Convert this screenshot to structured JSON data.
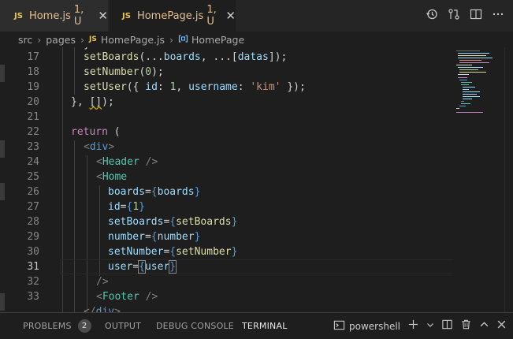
{
  "tabs": [
    {
      "icon": "JS",
      "label": "Home.js",
      "status": "1, U",
      "close": "✕"
    },
    {
      "icon": "JS",
      "label": "HomePage.js",
      "status": "1, U",
      "close": "✕"
    }
  ],
  "breadcrumb": {
    "items": [
      "src",
      "pages",
      "HomePage.js",
      "HomePage"
    ],
    "file_icon": "JS",
    "separator": "›"
  },
  "editor": {
    "line_numbers": [
      "17",
      "18",
      "19",
      "20",
      "21",
      "22",
      "23",
      "24",
      "25",
      "26",
      "27",
      "28",
      "29",
      "30",
      "31",
      "32",
      "33"
    ],
    "active_line": "31"
  },
  "panel": {
    "tabs": [
      "PROBLEMS",
      "OUTPUT",
      "DEBUG CONSOLE",
      "TERMINAL"
    ],
    "problems_count": "2",
    "active_tab": "TERMINAL",
    "shell": "powershell"
  },
  "colors": {
    "editor_bg": "#1e1e1e",
    "tab_bar_bg": "#252526",
    "modified_label": "#e2c08d",
    "js_icon": "#e8c650"
  }
}
